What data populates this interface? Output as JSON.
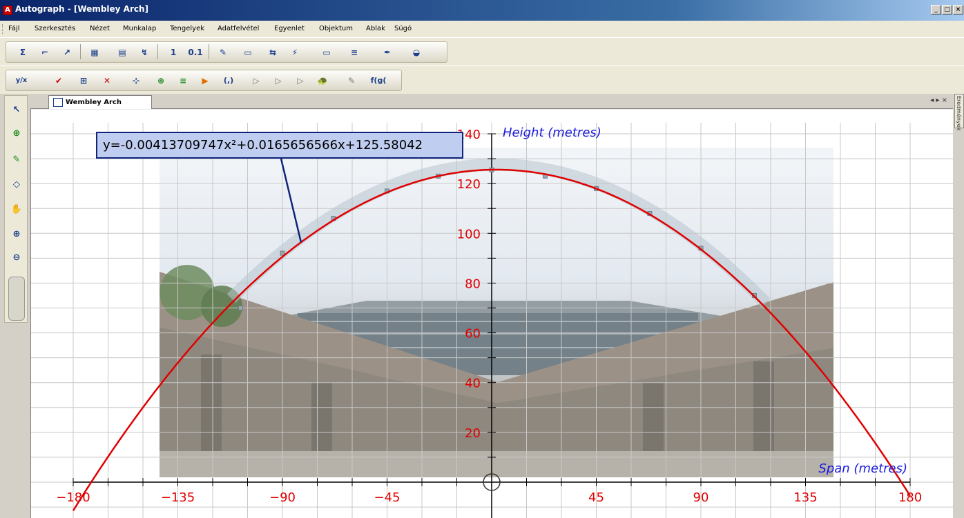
{
  "window": {
    "title": "Autograph - [Wembley Arch]",
    "minimize": "_",
    "restore": "□",
    "close": "×"
  },
  "menu": [
    "Fájl",
    "Szerkesztés",
    "Nézet",
    "Munkalap",
    "Tengelyek",
    "Adatfelvétel",
    "Egyenlet",
    "Objektum",
    "Ablak",
    "Súgó"
  ],
  "toolbar1": [
    "Σ",
    "⌐",
    "↗",
    "▦",
    "▤",
    "↯",
    "1",
    "0.1",
    "✎",
    "▭",
    "⇆",
    "⚡",
    "▭",
    "≡",
    "✒",
    "◒"
  ],
  "toolbar2": [
    "y/x",
    "✔",
    "⊞",
    "✕",
    "⊹",
    "⊕",
    "≡",
    "▶",
    "(,)",
    "▷",
    "▷",
    "▷",
    "🐢",
    "✎",
    "f(g("
  ],
  "lefttools": [
    "↖",
    "⊕",
    "✎",
    "◇",
    "✋",
    "⊕",
    "⊖"
  ],
  "tab": {
    "label": "Wembley Arch",
    "controls": "◂ ▸ ×"
  },
  "side_panel": {
    "label": "Eredmények"
  },
  "graph": {
    "equation": "y=-0.00413709747x²+0.0165656566x+125.58042",
    "y_axis_label": "Height (metres)",
    "x_axis_label": "Span (metres)",
    "x_ticks": [
      -180,
      -135,
      -90,
      -45,
      45,
      90,
      135,
      180
    ],
    "x_tick_labels": [
      "−180",
      "−135",
      "−90",
      "−45",
      "45",
      "90",
      "135",
      "180"
    ],
    "y_ticks": [
      20,
      40,
      60,
      80,
      100,
      120,
      140
    ],
    "y_tick_labels": [
      "20",
      "40",
      "60",
      "80",
      "100",
      "120",
      "140"
    ],
    "xlim": [
      -180,
      180
    ],
    "ylim": [
      0,
      140
    ],
    "curve": {
      "a": -0.00413709747,
      "b": 0.0165656566,
      "c": 125.58042
    },
    "data_points": [
      [
        -108,
        70
      ],
      [
        -90,
        92
      ],
      [
        -68,
        106
      ],
      [
        -45,
        117
      ],
      [
        -23,
        123
      ],
      [
        0,
        125.5
      ],
      [
        23,
        123
      ],
      [
        45,
        118
      ],
      [
        68,
        108
      ],
      [
        90,
        94
      ],
      [
        113,
        75
      ]
    ],
    "colors": {
      "curve": "#e00000",
      "tick_labels": "#e00000",
      "axis_labels": "#1a1adc",
      "grid": "#c8c8c8",
      "axes": "#000000"
    },
    "grid": true
  }
}
